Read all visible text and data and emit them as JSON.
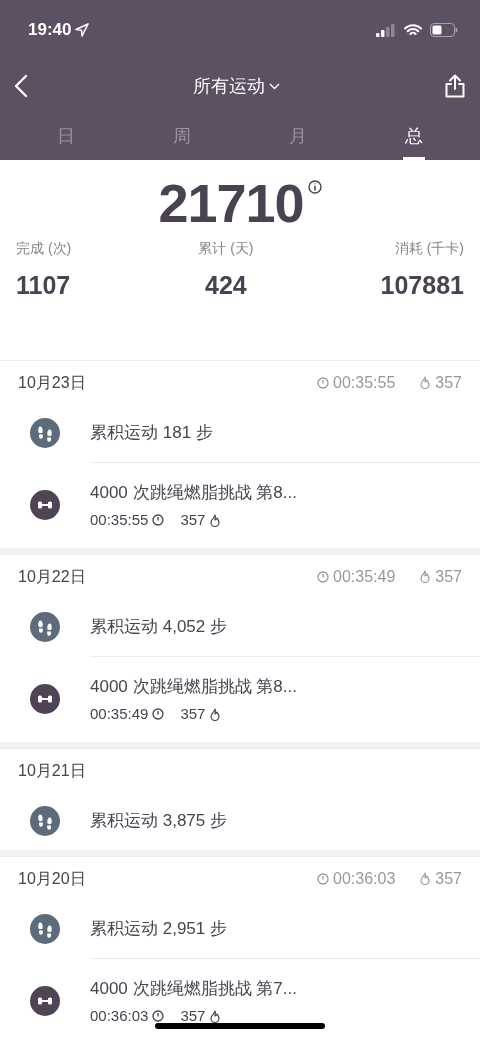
{
  "status_bar": {
    "time": "19:40"
  },
  "header": {
    "title": "所有运动"
  },
  "tabs": [
    {
      "label": "日",
      "selected": false
    },
    {
      "label": "周",
      "selected": false
    },
    {
      "label": "月",
      "selected": false
    },
    {
      "label": "总",
      "selected": true
    }
  ],
  "summary": {
    "total": "21710",
    "stats": [
      {
        "label": "完成 (次)",
        "value": "1107"
      },
      {
        "label": "累计 (天)",
        "value": "424"
      },
      {
        "label": "消耗 (千卡)",
        "value": "107881"
      }
    ]
  },
  "days": [
    {
      "date": "10月23日",
      "duration": "00:35:55",
      "calories": "357",
      "entries": [
        {
          "kind": "steps",
          "title": "累积运动 181 步"
        },
        {
          "kind": "workout",
          "title": "4000 次跳绳燃脂挑战  第8...",
          "duration": "00:35:55",
          "calories": "357"
        }
      ]
    },
    {
      "date": "10月22日",
      "duration": "00:35:49",
      "calories": "357",
      "entries": [
        {
          "kind": "steps",
          "title": "累积运动 4,052 步"
        },
        {
          "kind": "workout",
          "title": "4000 次跳绳燃脂挑战  第8...",
          "duration": "00:35:49",
          "calories": "357"
        }
      ]
    },
    {
      "date": "10月21日",
      "entries": [
        {
          "kind": "steps",
          "title": "累积运动 3,875 步"
        }
      ]
    },
    {
      "date": "10月20日",
      "duration": "00:36:03",
      "calories": "357",
      "entries": [
        {
          "kind": "steps",
          "title": "累积运动 2,951 步"
        },
        {
          "kind": "workout",
          "title": "4000 次跳绳燃脂挑战  第7...",
          "duration": "00:36:03",
          "calories": "357"
        }
      ]
    }
  ]
}
